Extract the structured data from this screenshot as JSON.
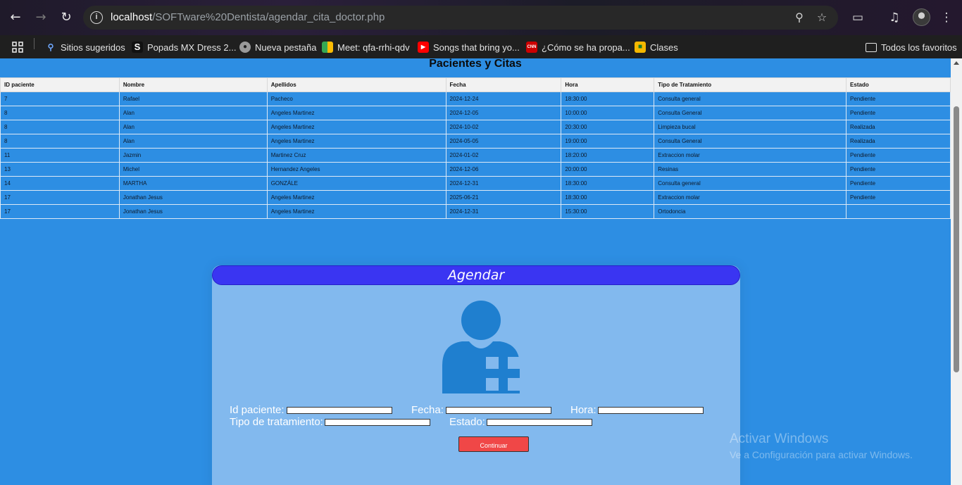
{
  "browser": {
    "url_host": "localhost",
    "url_path": "/SOFTware%20Dentista/agendar_cita_doctor.php",
    "bookmarks": [
      {
        "label": "Sitios sugeridos",
        "icon": "search-icon"
      },
      {
        "label": "Popads MX Dress 2...",
        "icon": "s-logo-icon"
      },
      {
        "label": "Nueva pestaña",
        "icon": "globe-icon"
      },
      {
        "label": "Meet: qfa-rrhi-qdv",
        "icon": "meet-icon"
      },
      {
        "label": "Songs that bring yo...",
        "icon": "youtube-icon"
      },
      {
        "label": "¿Cómo se ha propa...",
        "icon": "cnn-icon"
      },
      {
        "label": "Clases",
        "icon": "classroom-icon"
      }
    ],
    "all_bookmarks": "Todos los favoritos"
  },
  "page": {
    "title": "Pacientes y Citas",
    "table": {
      "headers": [
        "ID paciente",
        "Nombre",
        "Apellidos",
        "Fecha",
        "Hora",
        "Tipo de Tratamiento",
        "Estado"
      ],
      "rows": [
        [
          "7",
          "Rafael",
          "Pacheco",
          "2024-12-24",
          "18:30:00",
          "Consulta general",
          "Pendiente"
        ],
        [
          "8",
          "Alan",
          "Angeles Martinez",
          "2024-12-05",
          "10:00:00",
          "Consulta General",
          "Pendiente"
        ],
        [
          "8",
          "Alan",
          "Angeles Martinez",
          "2024-10-02",
          "20:30:00",
          "Limpieza bucal",
          "Realizada"
        ],
        [
          "8",
          "Alan",
          "Angeles Martinez",
          "2024-05-05",
          "19:00:00",
          "Consulta General",
          "Realizada"
        ],
        [
          "11",
          "Jazmin",
          "Martinez Cruz",
          "2024-01-02",
          "18:20:00",
          "Extraccion molar",
          "Pendiente"
        ],
        [
          "13",
          "Michel",
          "Hernandez Angeles",
          "2024-12-06",
          "20:00:00",
          "Resinas",
          "Pendiente"
        ],
        [
          "14",
          "MARTHA",
          "GONZÁLE",
          "2024-12-31",
          "18:30:00",
          "Consulta general",
          "Pendiente"
        ],
        [
          "17",
          "Jonathan Jesus",
          "Angeles Martinez",
          "2025-06-21",
          "18:30:00",
          "Extraccion molar",
          "Pendiente"
        ],
        [
          "17",
          "Jonathan Jesus",
          "Angeles Martinez",
          "2024-12-31",
          "15:30:00",
          "Ortodoncia",
          ""
        ]
      ]
    },
    "form": {
      "header": "Agendar",
      "labels": {
        "id": "Id paciente:",
        "fecha": "Fecha:",
        "hora": "Hora:",
        "tratamiento": "Tipo de tratamiento:",
        "estado": "Estado:"
      },
      "values": {
        "id": "",
        "fecha": "",
        "hora": "",
        "tratamiento": "",
        "estado": ""
      },
      "submit": "Continuar"
    }
  },
  "watermark": {
    "line1": "Activar Windows",
    "line2": "Ve a Configuración para activar Windows."
  },
  "colors": {
    "page_bg": "#2d8ee3",
    "card_bg": "#82b9ee",
    "card_header": "#3a35f2",
    "button": "#f04747",
    "icon": "#1f7fcf"
  }
}
